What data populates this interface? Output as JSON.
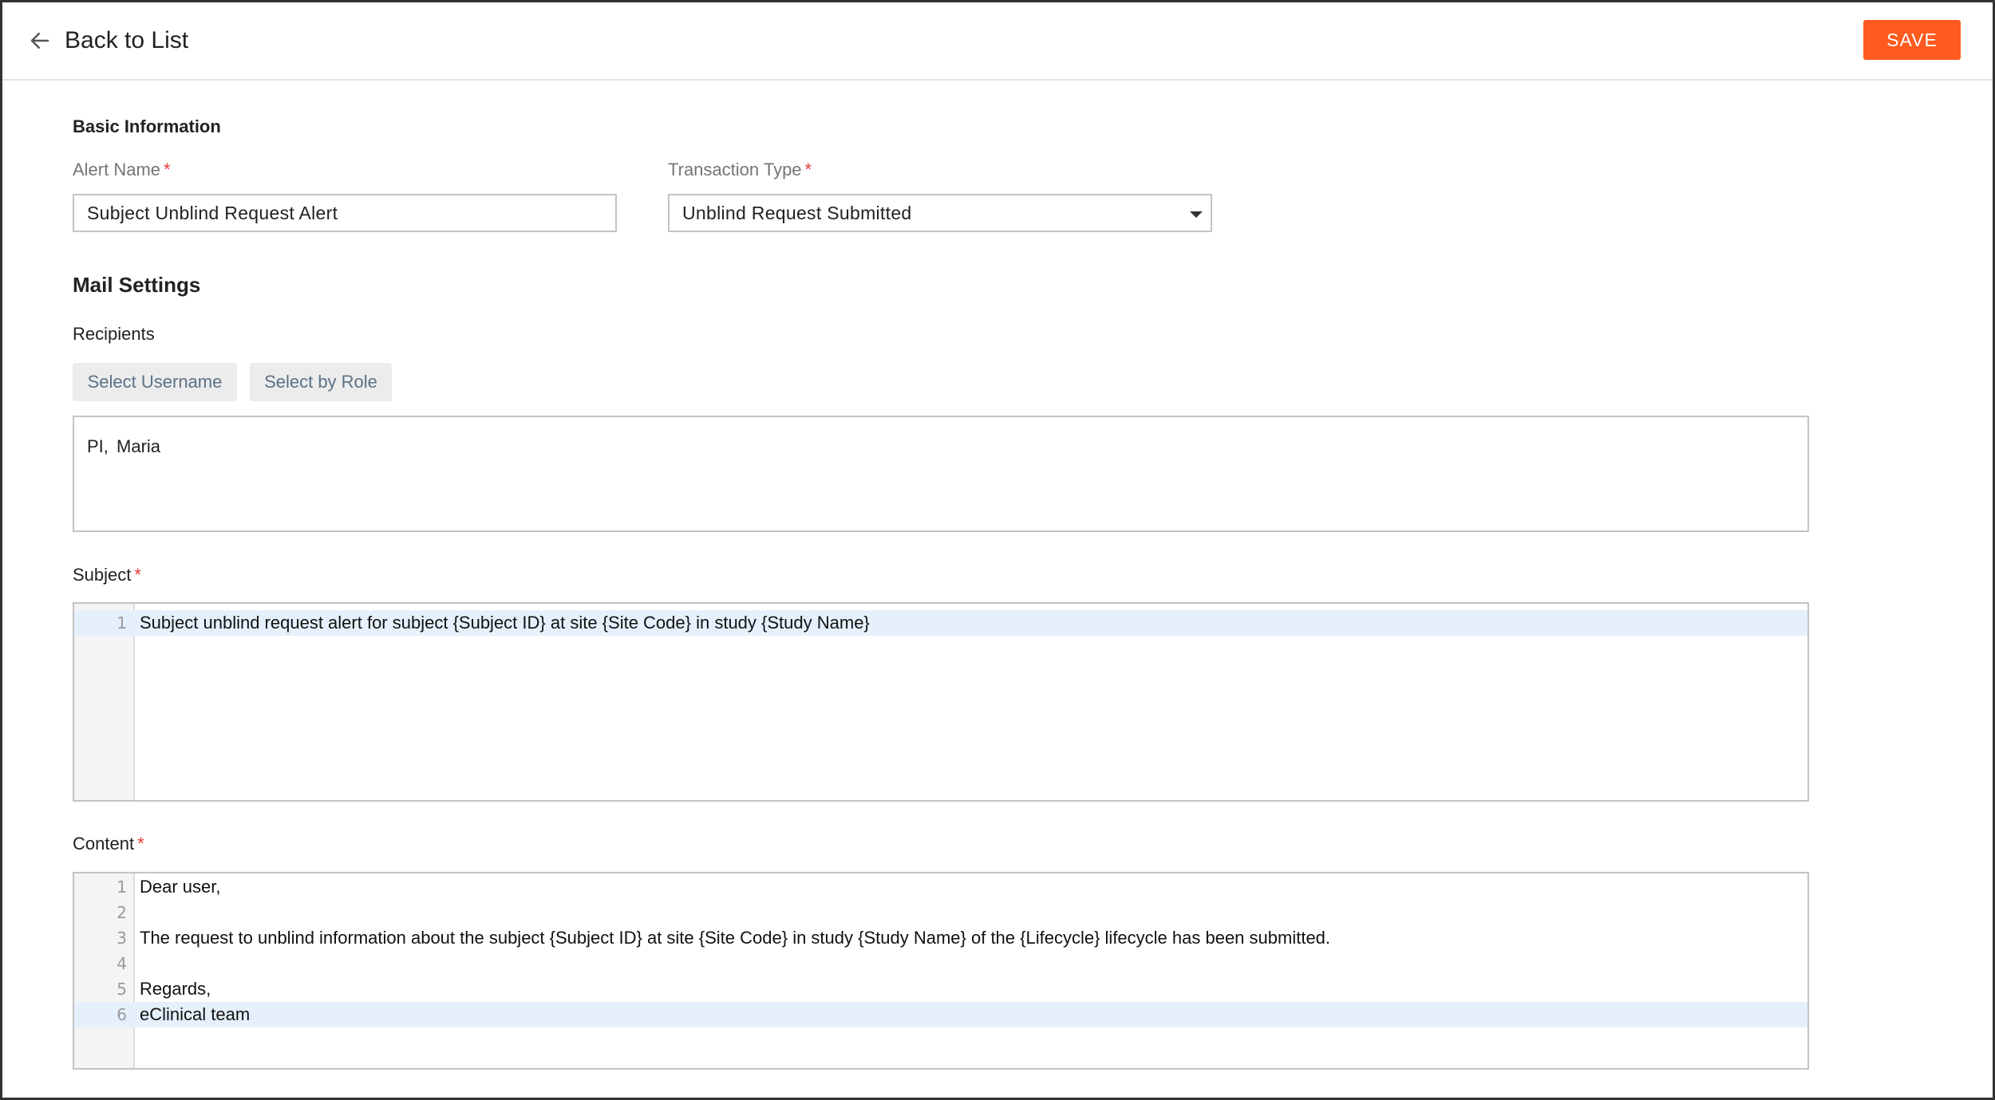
{
  "header": {
    "back_label": "Back to List",
    "save_label": "SAVE"
  },
  "basic_info": {
    "title": "Basic Information",
    "alert_name": {
      "label": "Alert Name",
      "required_mark": "*",
      "value": "Subject Unblind Request Alert"
    },
    "transaction_type": {
      "label": "Transaction Type",
      "required_mark": "*",
      "selected": "Unblind Request Submitted"
    }
  },
  "mail_settings": {
    "title": "Mail Settings",
    "recipients": {
      "label": "Recipients",
      "select_username_label": "Select Username",
      "select_by_role_label": "Select by Role",
      "value": "PI,  Maria"
    },
    "subject": {
      "label": "Subject",
      "required_mark": "*",
      "lines": [
        {
          "no": "1",
          "text": "Subject unblind request alert for subject {Subject ID} at site {Site Code} in study {Study Name}"
        }
      ]
    },
    "content": {
      "label": "Content",
      "required_mark": "*",
      "lines": [
        {
          "no": "1",
          "text": "Dear user,"
        },
        {
          "no": "2",
          "text": ""
        },
        {
          "no": "3",
          "text": "The request to unblind information about the subject {Subject ID} at site {Site Code} in study {Study Name} of the {Lifecycle} lifecycle has been submitted."
        },
        {
          "no": "4",
          "text": ""
        },
        {
          "no": "5",
          "text": "Regards,"
        },
        {
          "no": "6",
          "text": "eClinical team"
        }
      ]
    }
  },
  "colors": {
    "accent": "#ff5a1f",
    "required": "#e53935",
    "active_line": "#e6f0fd"
  }
}
